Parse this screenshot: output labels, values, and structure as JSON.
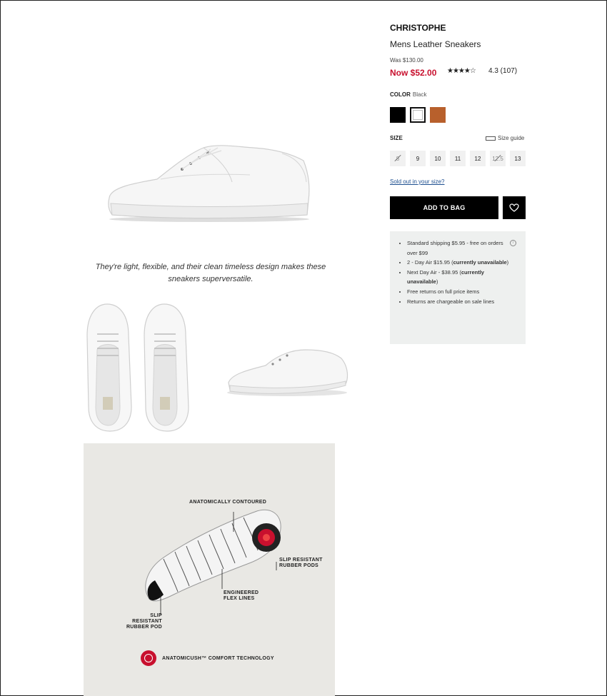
{
  "product": {
    "brand": "CHRISTOPHE",
    "name": "Mens Leather Sneakers",
    "was_price": "Was $130.00",
    "now_price": "Now $52.00",
    "rating_stars": "★★★★☆",
    "rating_text": "4.3 (107)",
    "rating_value": 4.3
  },
  "color": {
    "label": "COLOR",
    "value": "Black",
    "swatches": [
      {
        "name": "Black",
        "hex": "#000000"
      },
      {
        "name": "White",
        "hex": "#ffffff"
      },
      {
        "name": "Tan",
        "hex": "#b8602c"
      }
    ]
  },
  "size": {
    "label": "SIZE",
    "guide_label": "Size guide",
    "options": [
      {
        "label": "8",
        "sold_out": true
      },
      {
        "label": "9",
        "sold_out": false
      },
      {
        "label": "10",
        "sold_out": false
      },
      {
        "label": "11",
        "sold_out": false
      },
      {
        "label": "12",
        "sold_out": false
      },
      {
        "label": "12.5",
        "sold_out": true
      },
      {
        "label": "13",
        "sold_out": false
      }
    ],
    "sold_out_link": "Sold out in your size?"
  },
  "actions": {
    "add_to_bag": "ADD TO BAG",
    "wishlist_icon": "heart-icon"
  },
  "shipping": {
    "items": [
      "Standard shipping $5.95 - free on orders over $99",
      [
        "2 - Day Air $15.95 (",
        "currently unavailable",
        ")"
      ],
      [
        "Next Day Air - $38.95 (",
        "currently unavailable",
        ")"
      ],
      "Free returns on full price items",
      "Returns are chargeable on sale lines"
    ],
    "info_icon": "info-icon"
  },
  "gallery": {
    "tagline": "They're light, flexible, and their clean timeless design makes these sneakers superversatile.",
    "callouts": {
      "contoured": "ANATOMICALLY CONTOURED",
      "pods_right": "SLIP RESISTANT RUBBER PODS",
      "flex": "ENGINEERED FLEX LINES",
      "pod_left": "SLIP RESISTANT RUBBER POD"
    },
    "comfort": "ANATOMICUSH™ COMFORT TECHNOLOGY"
  },
  "colors": {
    "sale_red": "#c8102e",
    "button_black": "#000000",
    "shipping_bg": "#eef0ef",
    "tech_bg": "#e9e8e4"
  }
}
